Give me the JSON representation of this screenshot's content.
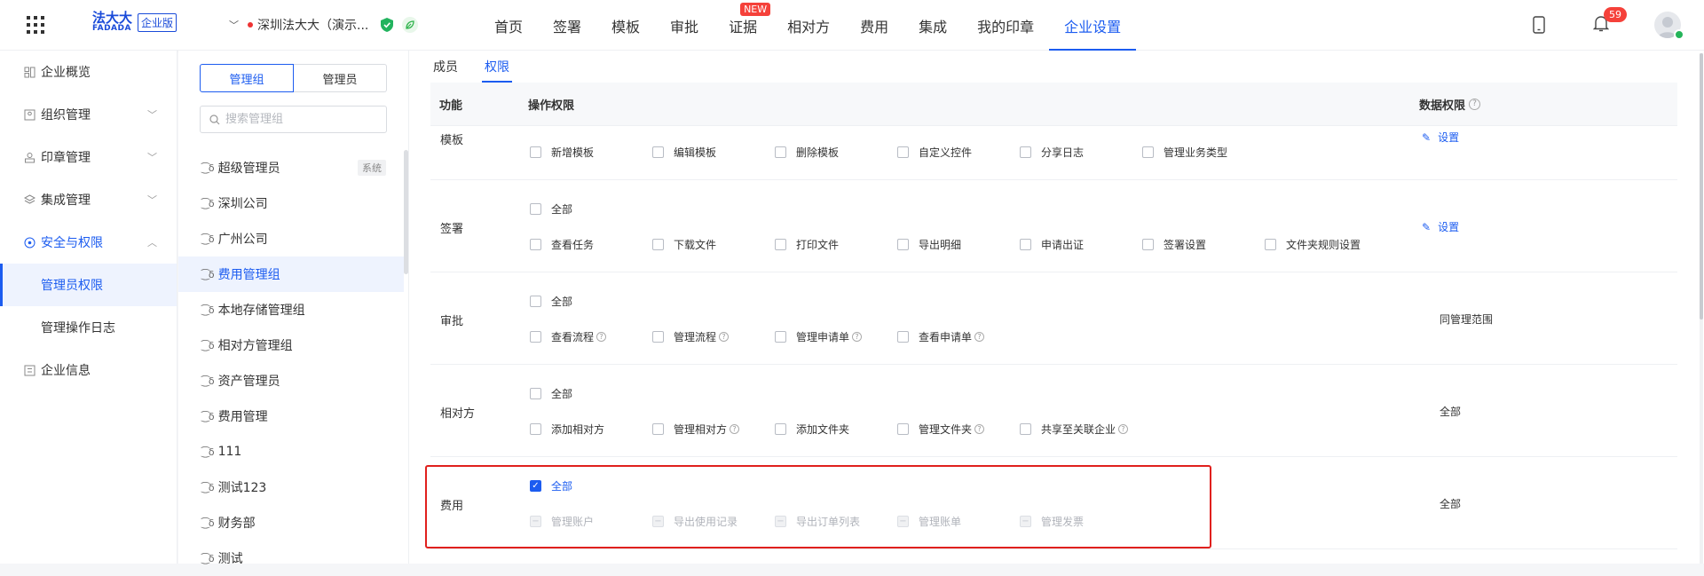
{
  "header": {
    "logo_cn": "法大大",
    "logo_en": "FADADA",
    "logo_badge": "企业版",
    "company": "深圳法大大（演示...",
    "nav": [
      {
        "label": "首页"
      },
      {
        "label": "签署"
      },
      {
        "label": "模板"
      },
      {
        "label": "审批"
      },
      {
        "label": "证据",
        "badge": "NEW"
      },
      {
        "label": "相对方"
      },
      {
        "label": "费用"
      },
      {
        "label": "集成"
      },
      {
        "label": "我的印章"
      },
      {
        "label": "企业设置"
      }
    ],
    "notification_count": "59"
  },
  "sidebar": {
    "items": [
      {
        "label": "企业概览",
        "icon": "overview-icon"
      },
      {
        "label": "组织管理",
        "icon": "org-icon"
      },
      {
        "label": "印章管理",
        "icon": "seal-icon"
      },
      {
        "label": "集成管理",
        "icon": "integration-icon"
      },
      {
        "label": "安全与权限",
        "icon": "security-icon"
      },
      {
        "label": "企业信息",
        "icon": "info-icon"
      }
    ],
    "sub_items": [
      {
        "label": "管理员权限"
      },
      {
        "label": "管理操作日志"
      }
    ]
  },
  "group_panel": {
    "tab_groups": "管理组",
    "tab_admins": "管理员",
    "search_placeholder": "搜索管理组",
    "system_tag": "系统",
    "groups": [
      {
        "label": "超级管理员"
      },
      {
        "label": "深圳公司"
      },
      {
        "label": "广州公司"
      },
      {
        "label": "费用管理组"
      },
      {
        "label": "本地存储管理组"
      },
      {
        "label": "相对方管理组"
      },
      {
        "label": "资产管理员"
      },
      {
        "label": "费用管理"
      },
      {
        "label": "111"
      },
      {
        "label": "测试123"
      },
      {
        "label": "财务部"
      },
      {
        "label": "测试"
      }
    ]
  },
  "main": {
    "tabs": [
      {
        "label": "成员"
      },
      {
        "label": "权限"
      }
    ],
    "columns": {
      "func": "功能",
      "ops": "操作权限",
      "data": "数据权限"
    },
    "set_label": "设置",
    "rows": {
      "template": {
        "name": "模板",
        "ops": [
          "新增模板",
          "编辑模板",
          "删除模板",
          "自定义控件",
          "分享日志",
          "管理业务类型"
        ]
      },
      "sign": {
        "name": "签署",
        "all": "全部",
        "ops": [
          "查看任务",
          "下载文件",
          "打印文件",
          "导出明细",
          "申请出证",
          "签署设置",
          "文件夹规则设置"
        ]
      },
      "approval": {
        "name": "审批",
        "all": "全部",
        "ops": [
          "查看流程",
          "管理流程",
          "管理申请单",
          "查看申请单"
        ],
        "data": "同管理范围"
      },
      "counterparty": {
        "name": "相对方",
        "all": "全部",
        "ops": [
          "添加相对方",
          "管理相对方",
          "添加文件夹",
          "管理文件夹",
          "共享至关联企业"
        ],
        "data": "全部"
      },
      "fee": {
        "name": "费用",
        "all": "全部",
        "ops": [
          "管理账户",
          "导出使用记录",
          "导出订单列表",
          "管理账单",
          "管理发票"
        ],
        "data": "全部"
      }
    }
  }
}
